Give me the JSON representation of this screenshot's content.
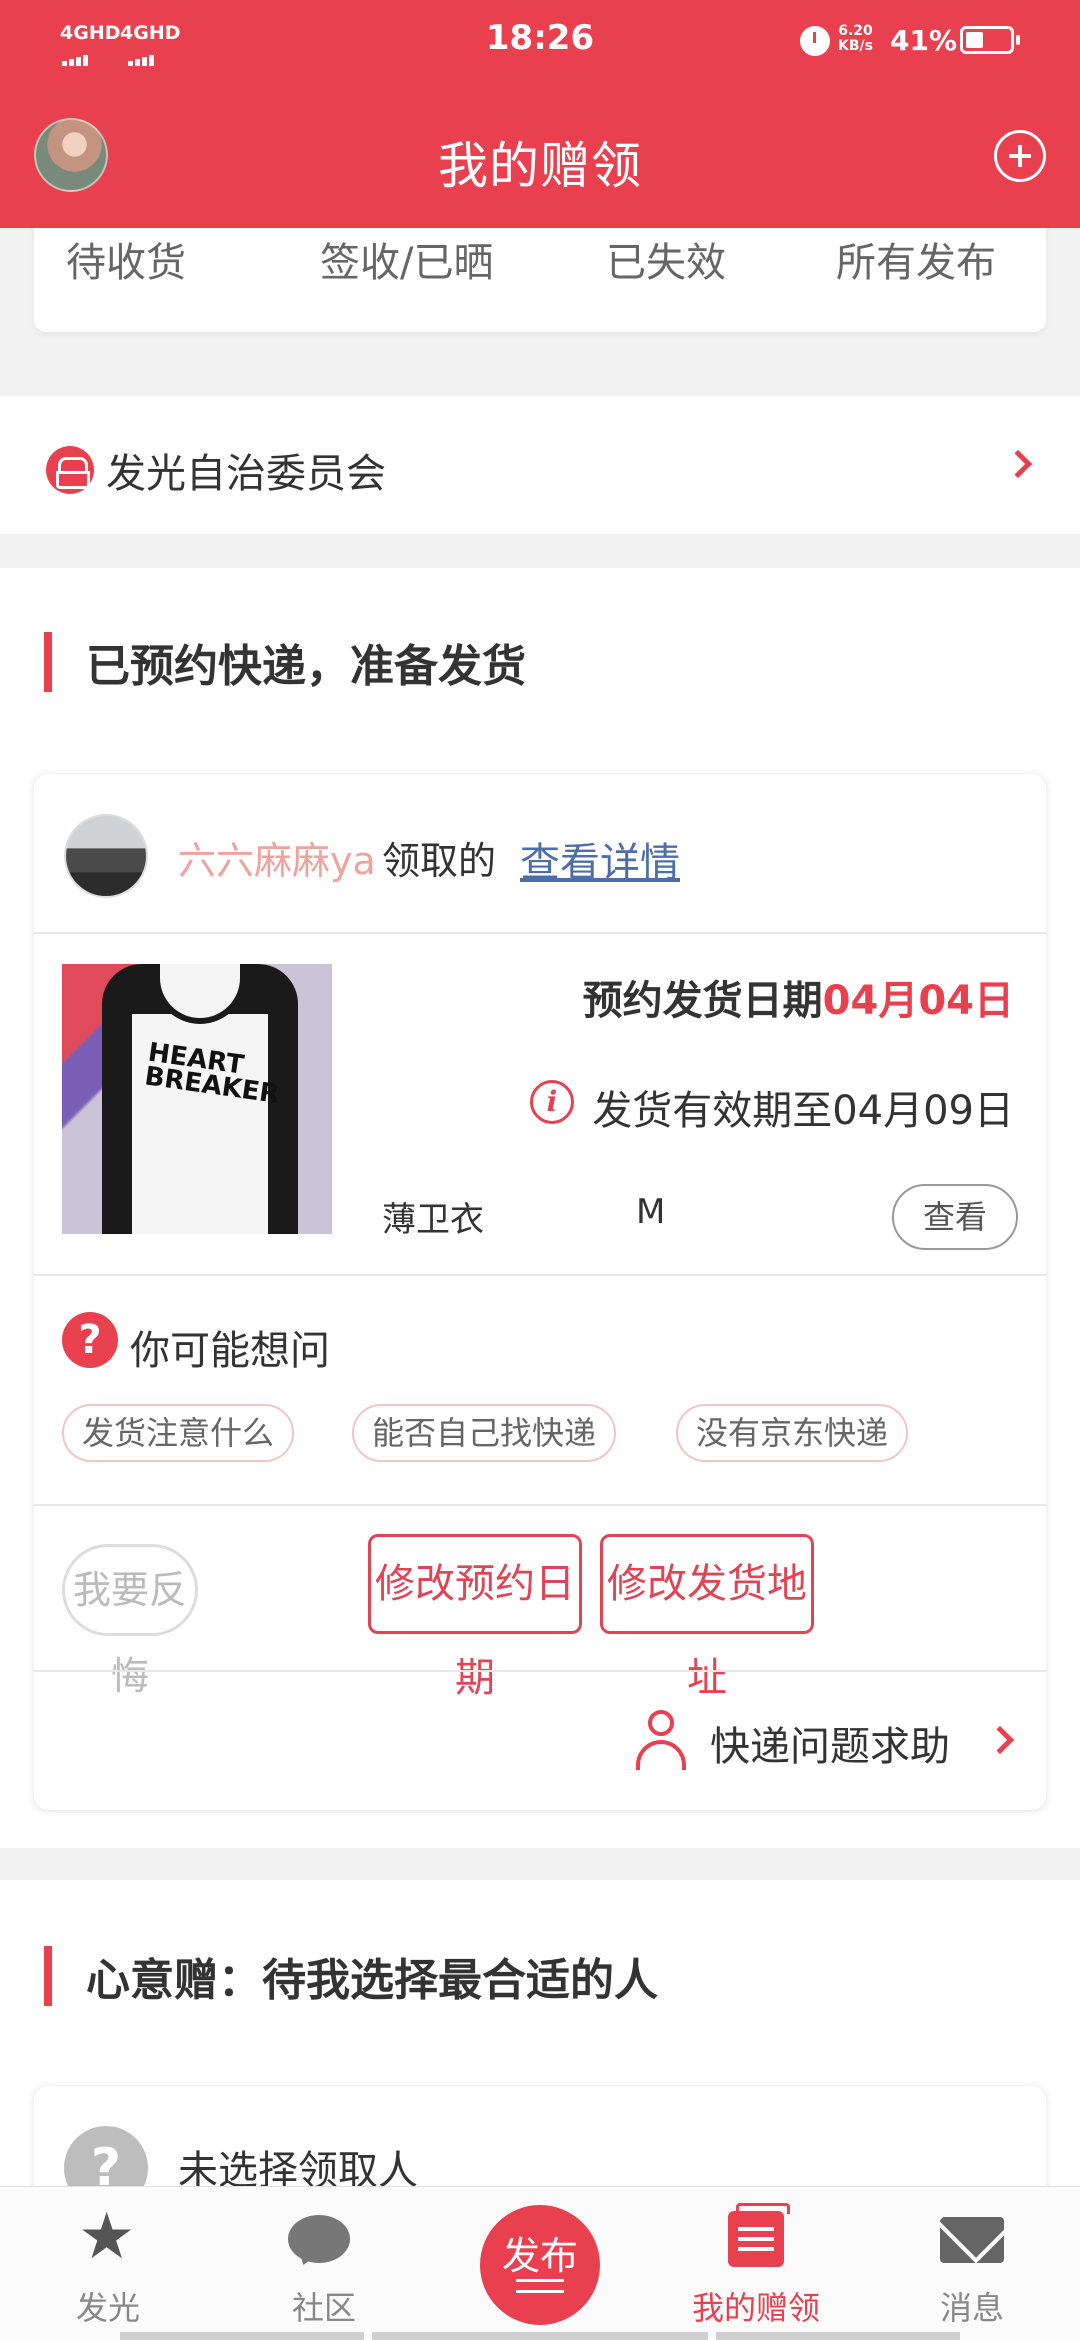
{
  "status_bar": {
    "network_1": "4GHD",
    "network_2": "4GHD",
    "time": "18:26",
    "net_speed_value": "6.20",
    "net_speed_unit": "KB/s",
    "battery_percent": "41%",
    "battery_level": 0.41
  },
  "header": {
    "title": "我的赠领",
    "add_icon": "plus-circle-icon"
  },
  "tabs": [
    "待收货",
    "签收/已晒",
    "已失效",
    "所有发布"
  ],
  "committee": {
    "label": "发光自治委员会",
    "icon": "committee-icon"
  },
  "section_shipping": {
    "title": "已预约快递，准备发货"
  },
  "order": {
    "claimer_name": "六六麻麻ya",
    "claimed_text": "领取的",
    "detail_link": "查看详情",
    "image_print": "HEART BREAKER",
    "ship_date_label": "预约发货日期",
    "ship_date_value": "04月04日",
    "validity_text": "发货有效期至04月09日",
    "product_name": "薄卫衣",
    "product_size": "M",
    "view_button": "查看"
  },
  "faq": {
    "title": "你可能想问",
    "chips": [
      "发货注意什么",
      "能否自己找快递",
      "没有京东快递"
    ]
  },
  "actions": {
    "regret": "我要反悔",
    "change_date": "修改预约日期",
    "change_address": "修改发货地址",
    "courier_help": "快递问题求助"
  },
  "section_heart": {
    "title": "心意赠：待我选择最合适的人",
    "unselected": "未选择领取人"
  },
  "bottom_nav": {
    "items": [
      {
        "label": "发光",
        "icon": "star-icon"
      },
      {
        "label": "社区",
        "icon": "chat-bubble-icon"
      },
      {
        "label": "发布",
        "icon": "publish-icon"
      },
      {
        "label": "我的赠领",
        "icon": "gift-box-icon",
        "active": true
      },
      {
        "label": "消息",
        "icon": "mail-icon"
      }
    ]
  },
  "colors": {
    "brand": "#e8404f",
    "link": "#4e6ea8",
    "claimer_name": "#f0a39e"
  }
}
